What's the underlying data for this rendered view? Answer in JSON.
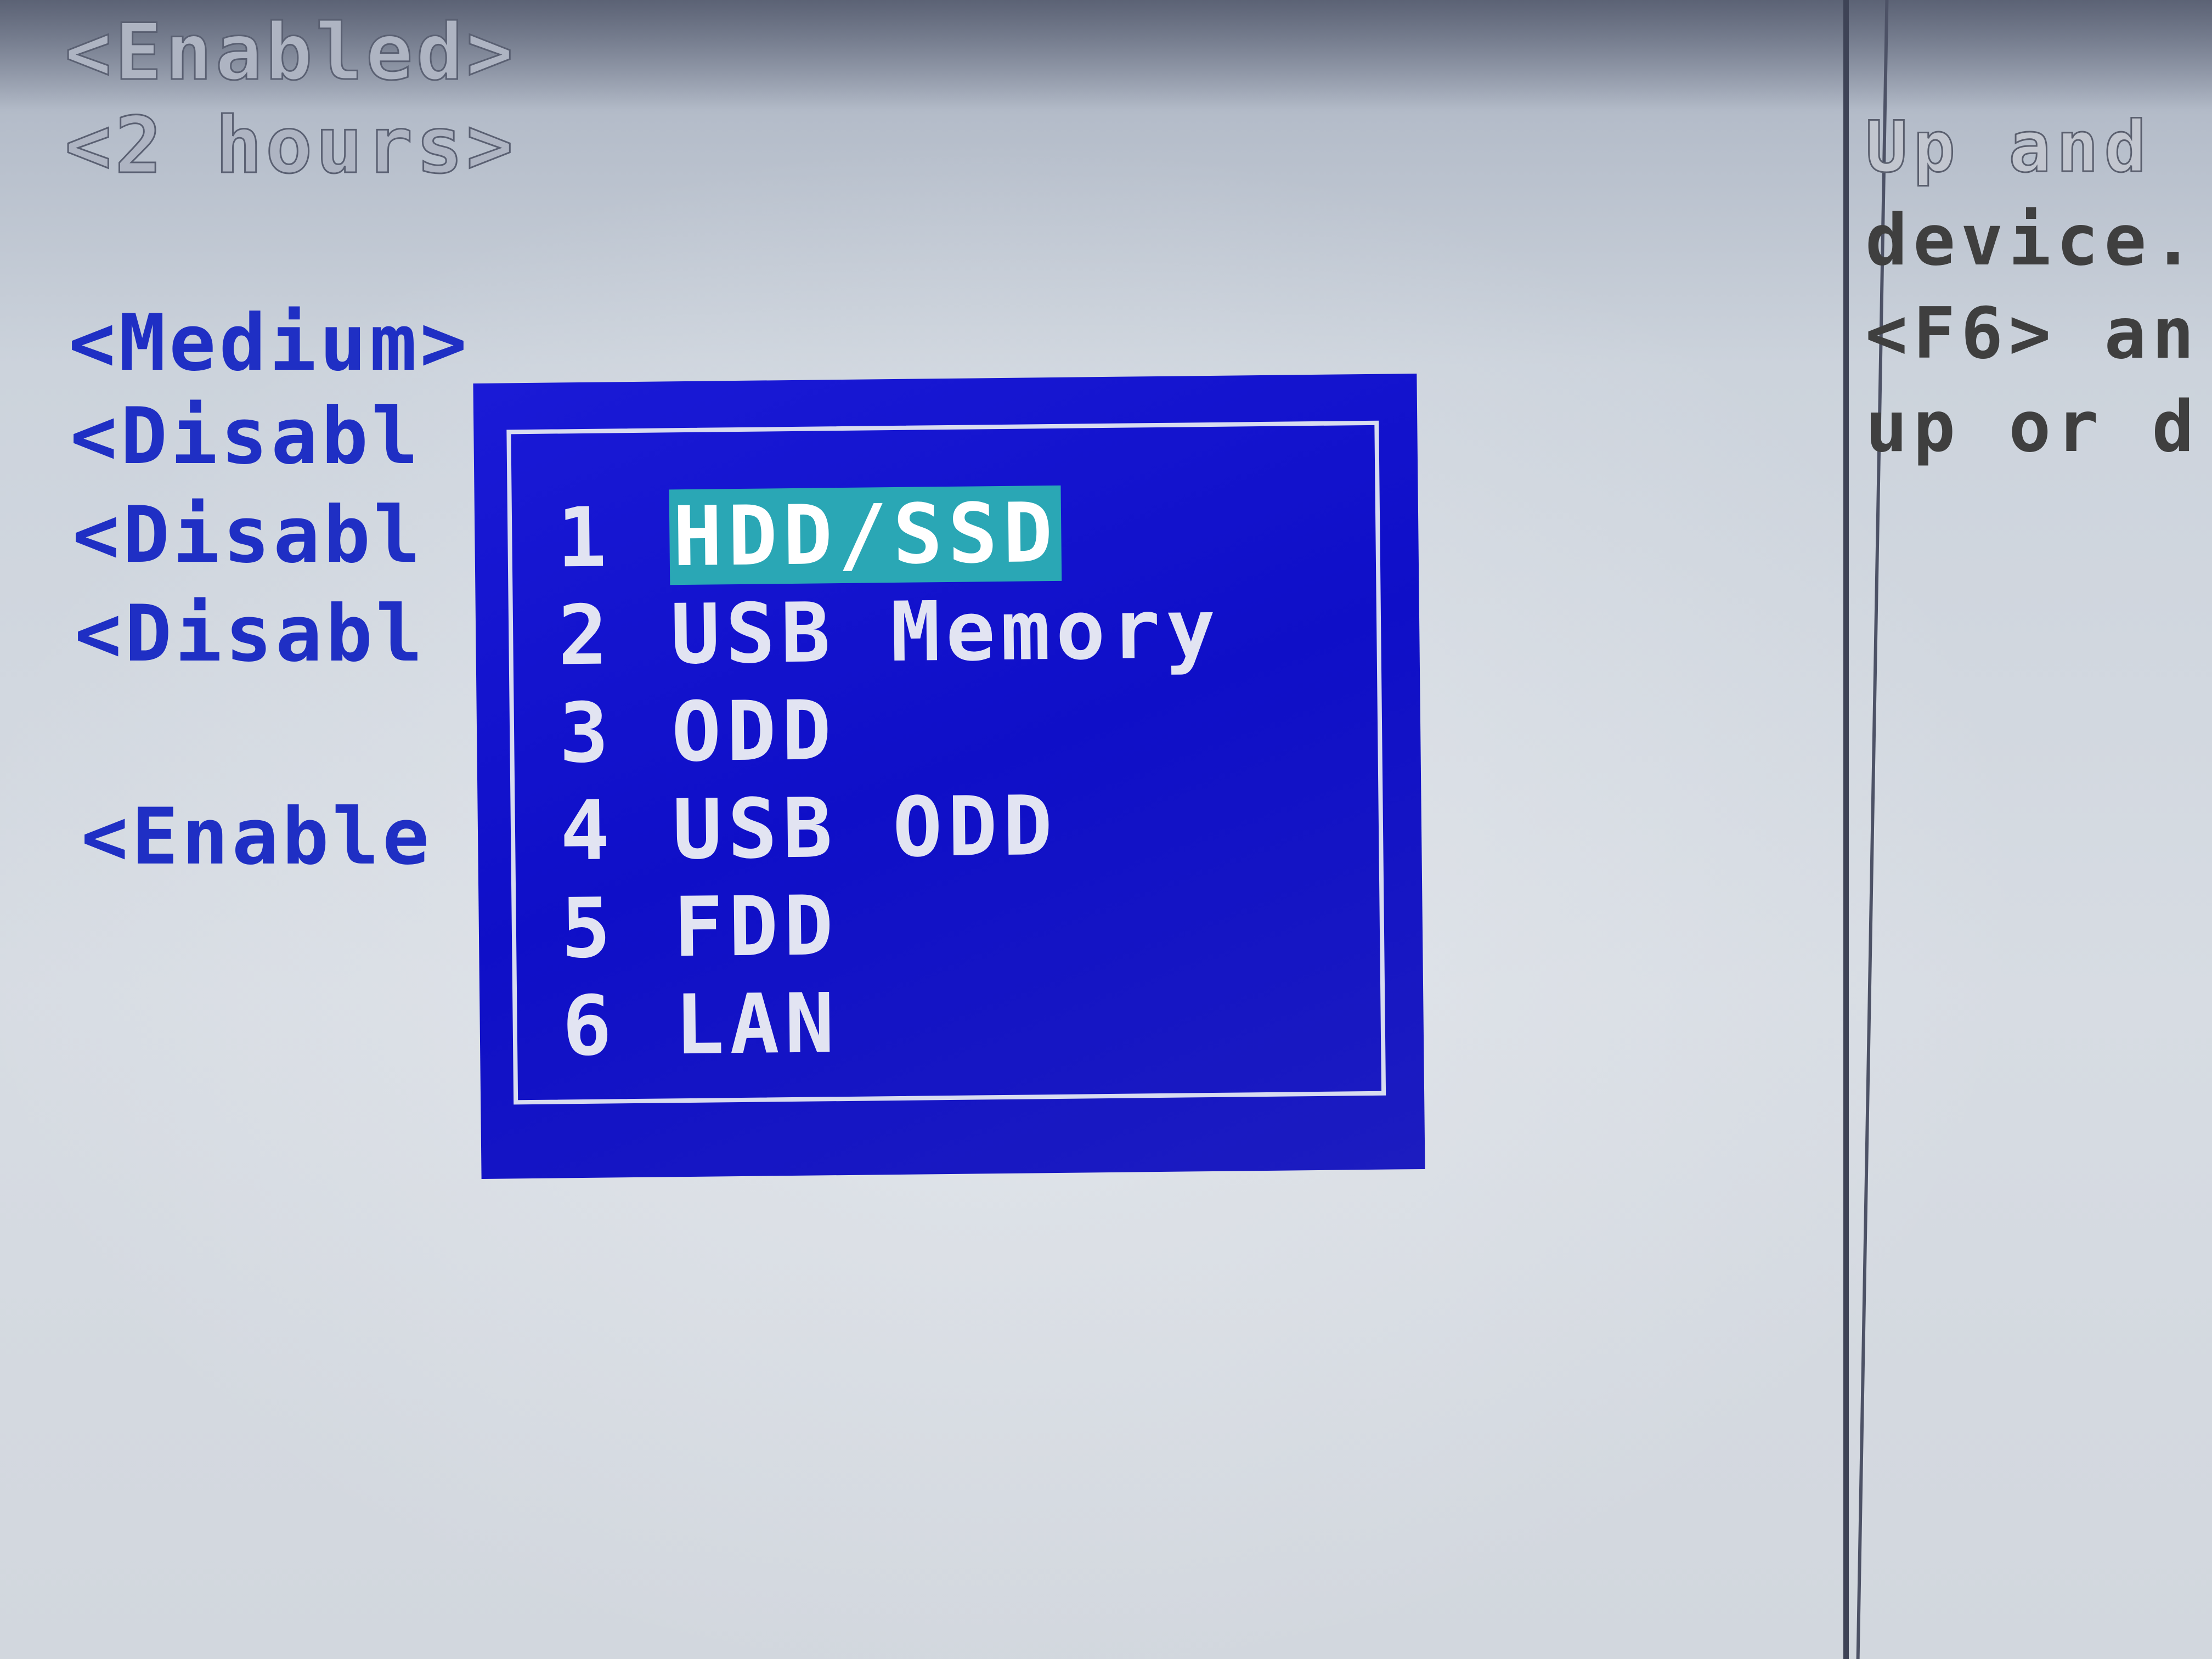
{
  "settings_column": {
    "values": [
      "<Enabled>",
      "<2 hours>",
      "<Medium>",
      "<Disabl",
      "<Disabl",
      "<Disabl",
      "<Enable"
    ]
  },
  "help_panel": {
    "lines": [
      "Up and",
      "device.",
      "<F6> an",
      "up or d"
    ]
  },
  "boot_menu": {
    "selected_index": 0,
    "items": [
      {
        "number": "1",
        "label": "HDD/SSD"
      },
      {
        "number": "2",
        "label": "USB Memory"
      },
      {
        "number": "3",
        "label": "ODD"
      },
      {
        "number": "4",
        "label": "USB ODD"
      },
      {
        "number": "5",
        "label": "FDD"
      },
      {
        "number": "6",
        "label": "LAN"
      }
    ]
  },
  "colors": {
    "menu_background": "#1414d0",
    "menu_border": "#d8dcf0",
    "menu_text": "#e2e4f2",
    "selection_highlight": "#2aa7b5",
    "value_text": "#1f2fc4",
    "screen_background": "#d3d8df"
  }
}
